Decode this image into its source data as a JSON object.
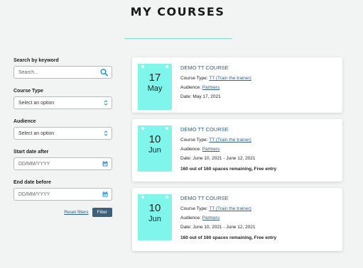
{
  "page": {
    "title": "MY COURSES"
  },
  "filters": {
    "keyword_label": "Search by keyword",
    "keyword_placeholder": "Search...",
    "course_type_label": "Course Type",
    "course_type_value": "Select an option",
    "audience_label": "Audience",
    "audience_value": "Select an option",
    "start_label": "Start date after",
    "start_placeholder": "DD/MM/YYYY",
    "end_label": "End date before",
    "end_placeholder": "DD/MM/YYYY",
    "reset_label": "Reset filters",
    "filter_label": "Filter"
  },
  "labels": {
    "course_type": "Course Type: ",
    "audience": "Audience: ",
    "date": "Date: "
  },
  "courses": [
    {
      "day": "17",
      "month": "May",
      "title": "DEMO TT COURSE",
      "course_type": "TT (Train the trainer)",
      "audience": "Partners",
      "date": "May 17, 2021",
      "spaces": ""
    },
    {
      "day": "10",
      "month": "Jun",
      "title": "DEMO TT COURSE",
      "course_type": "TT (Train the trainer)",
      "audience": "Partners",
      "date": "June 10, 2021 - June 12, 2021",
      "spaces": "160 out of 160 spaces remaining, Free entry"
    },
    {
      "day": "10",
      "month": "Jun",
      "title": "DEMO TT COURSE",
      "course_type": "TT (Train the trainer)",
      "audience": "Partners",
      "date": "June 10, 2021 - June 12, 2021",
      "spaces": "160 out of 160 spaces remaining, Free entry"
    }
  ],
  "colors": {
    "accent": "#7ff5ec",
    "link": "#2c5f8a",
    "button": "#3d5f7a",
    "icon": "#2a8fc4"
  },
  "icons": {
    "search": "search-icon",
    "select": "chevron-updown-icon",
    "calendar": "calendar-icon"
  }
}
